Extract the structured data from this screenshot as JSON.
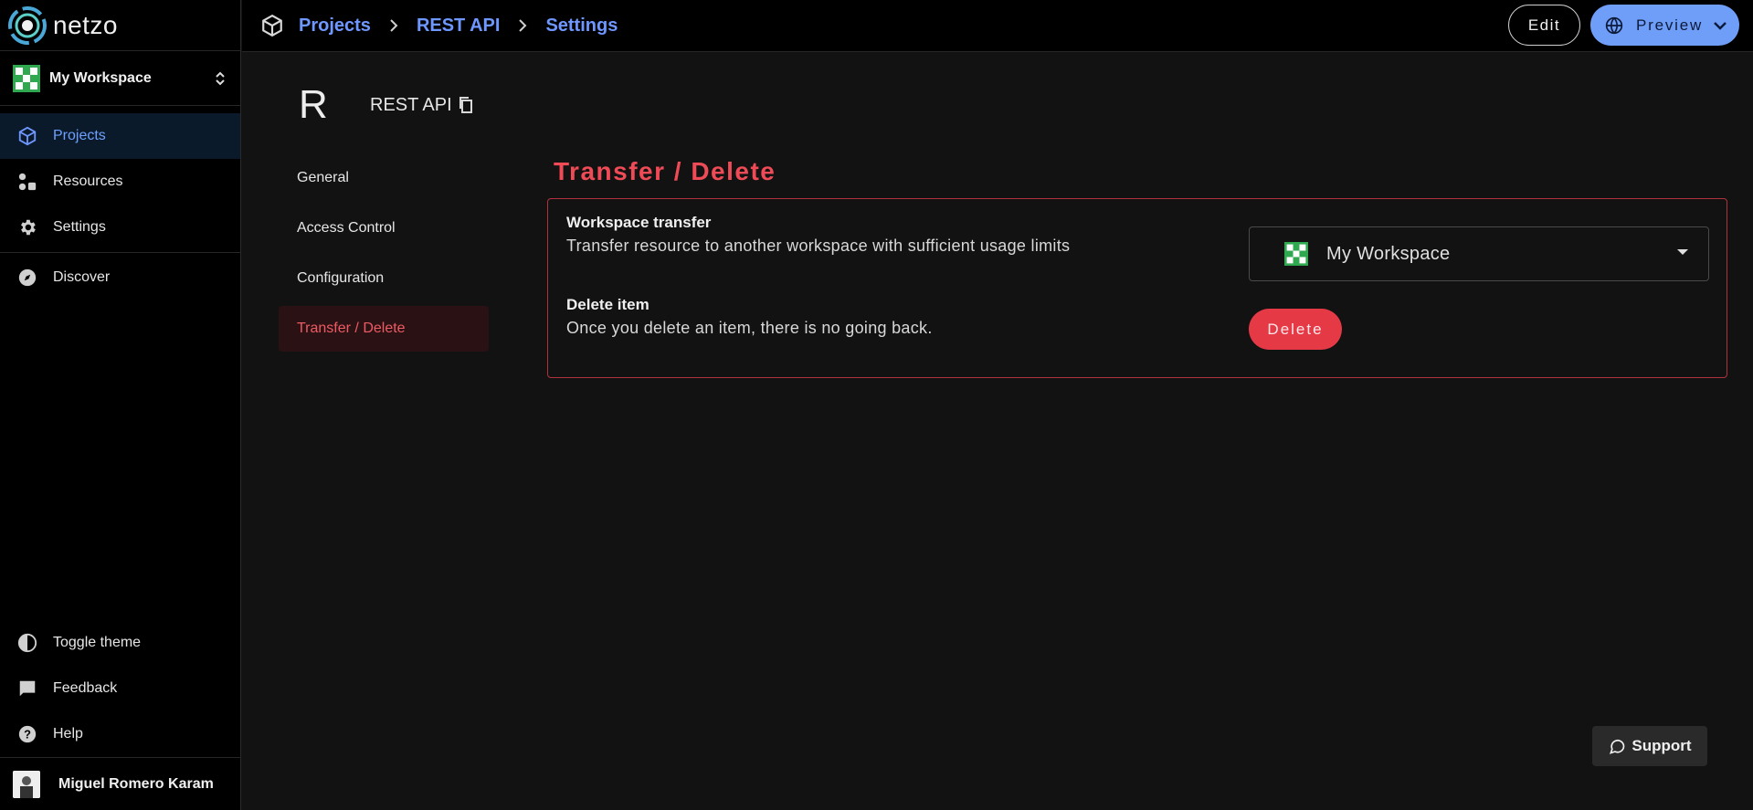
{
  "app": {
    "name": "netzo"
  },
  "workspace": {
    "name": "My Workspace"
  },
  "sidebar": {
    "items": [
      {
        "label": "Projects",
        "icon": "cube-icon",
        "active": true
      },
      {
        "label": "Resources",
        "icon": "resources-icon",
        "active": false
      },
      {
        "label": "Settings",
        "icon": "gear-icon",
        "active": false
      },
      {
        "label": "Discover",
        "icon": "compass-icon",
        "active": false
      }
    ],
    "bottom_items": [
      {
        "label": "Toggle theme",
        "icon": "contrast-icon"
      },
      {
        "label": "Feedback",
        "icon": "chat-icon"
      },
      {
        "label": "Help",
        "icon": "help-icon"
      }
    ],
    "user": {
      "name": "Miguel Romero Karam"
    }
  },
  "breadcrumb": [
    "Projects",
    "REST API",
    "Settings"
  ],
  "toolbar": {
    "edit_label": "Edit",
    "preview_label": "Preview"
  },
  "resource": {
    "initial": "R",
    "name": "REST API"
  },
  "subnav": {
    "items": [
      {
        "label": "General",
        "active": false
      },
      {
        "label": "Access Control",
        "active": false
      },
      {
        "label": "Configuration",
        "active": false
      },
      {
        "label": "Transfer / Delete",
        "active": true
      }
    ]
  },
  "danger": {
    "title": "Transfer / Delete",
    "transfer": {
      "title": "Workspace transfer",
      "description": "Transfer resource to another workspace with sufficient usage limits",
      "selected_workspace": "My Workspace"
    },
    "delete": {
      "title": "Delete item",
      "description": "Once you delete an item, there is no going back.",
      "button_label": "Delete"
    }
  },
  "support": {
    "label": "Support"
  },
  "colors": {
    "accent": "#6e97ff",
    "danger": "#ef4b57",
    "danger_button": "#e53946"
  }
}
